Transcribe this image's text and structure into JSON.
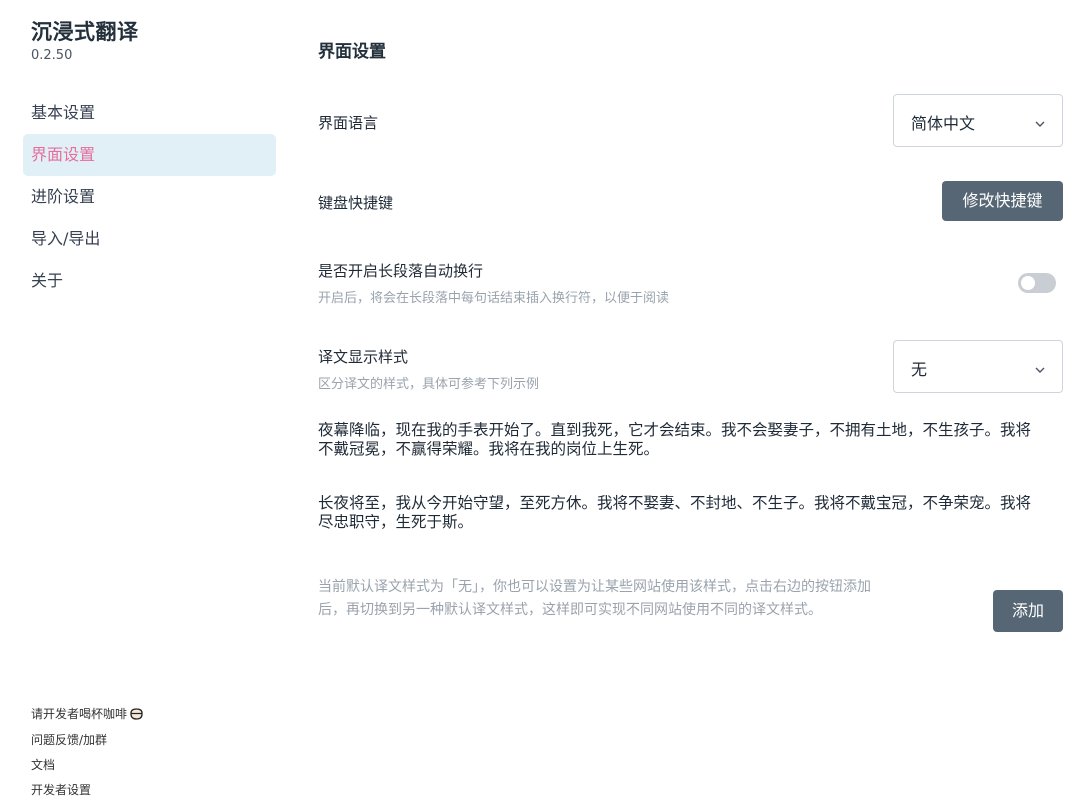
{
  "app": {
    "title": "沉浸式翻译",
    "version": "0.2.50"
  },
  "sidebar": {
    "items": [
      {
        "label": "基本设置",
        "active": false
      },
      {
        "label": "界面设置",
        "active": true
      },
      {
        "label": "进阶设置",
        "active": false
      },
      {
        "label": "导入/导出",
        "active": false
      },
      {
        "label": "关于",
        "active": false
      }
    ],
    "footer": {
      "coffee": "请开发者喝杯咖啡",
      "feedback": "问题反馈/加群",
      "docs": "文档",
      "dev": "开发者设置"
    }
  },
  "main": {
    "title": "界面设置",
    "language": {
      "label": "界面语言",
      "value": "简体中文"
    },
    "shortcut": {
      "label": "键盘快捷键",
      "button": "修改快捷键"
    },
    "linebreak": {
      "label": "是否开启长段落自动换行",
      "description": "开启后，将会在长段落中每句话结束插入换行符，以便于阅读",
      "enabled": false
    },
    "style": {
      "label": "译文显示样式",
      "description": "区分译文的样式，具体可参考下列示例",
      "value": "无"
    },
    "sample_original": "夜幕降临，现在我的手表开始了。直到我死，它才会结束。我不会娶妻子，不拥有土地，不生孩子。我将不戴冠冕，不赢得荣耀。我将在我的岗位上生死。",
    "sample_translation": "长夜将至，我从今开始守望，至死方休。我将不娶妻、不封地、不生子。我将不戴宝冠，不争荣宠。我将尽忠职守，生死于斯。",
    "hint": "当前默认译文样式为「无」，你也可以设置为让某些网站使用该样式，点击右边的按钮添加后，再切换到另一种默认译文样式，这样即可实现不同网站使用不同的译文样式。",
    "add_button": "添加"
  },
  "colors": {
    "accent_active_text": "#e56e9c",
    "active_bg": "#e1f0f7",
    "button_bg": "#566675"
  }
}
